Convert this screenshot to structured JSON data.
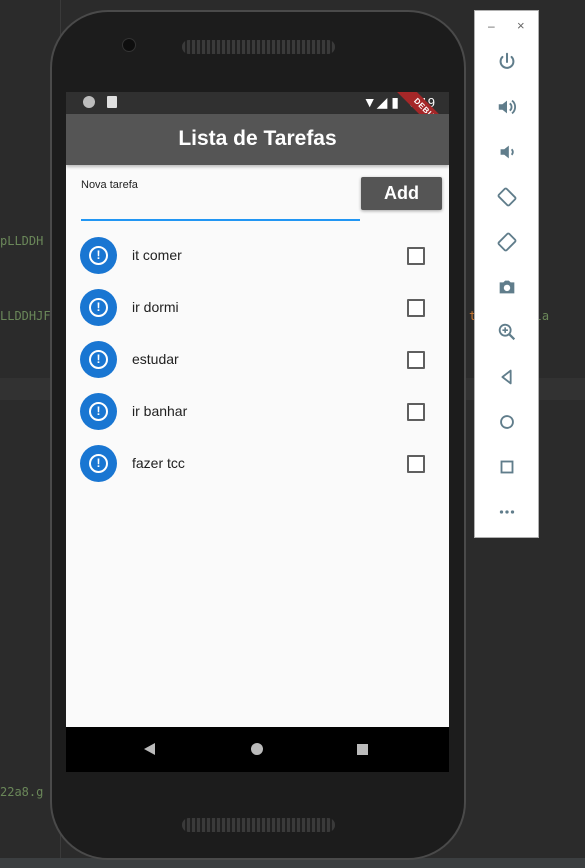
{
  "ide": {
    "code_lines": [
      "pLLDDH",
      "LLDDHJF",
      "22a8.g",
      "t",
      "=g&la"
    ]
  },
  "status_bar": {
    "time": "3:19",
    "icons": "▼◢ ▮",
    "debug_label": "DEBUG"
  },
  "app": {
    "title": "Lista de Tarefas",
    "input_label": "Nova tarefa",
    "input_value": "",
    "add_button": "Add"
  },
  "tasks": [
    {
      "title": "it comer",
      "done": false
    },
    {
      "title": "ir dormi",
      "done": false
    },
    {
      "title": "estudar",
      "done": false
    },
    {
      "title": "ir banhar",
      "done": false
    },
    {
      "title": "fazer tcc",
      "done": false
    }
  ],
  "task_icon": "alert-circle-icon",
  "colors": {
    "appbar": "#555555",
    "accent": "#2196f3",
    "avatar": "#1976d2"
  },
  "emulator_panel": {
    "minimize": "–",
    "close": "×",
    "buttons": [
      "power-icon",
      "volume-up-icon",
      "volume-down-icon",
      "rotate-left-icon",
      "rotate-right-icon",
      "camera-icon",
      "zoom-icon",
      "back-icon",
      "home-icon",
      "overview-icon",
      "more-icon"
    ]
  }
}
